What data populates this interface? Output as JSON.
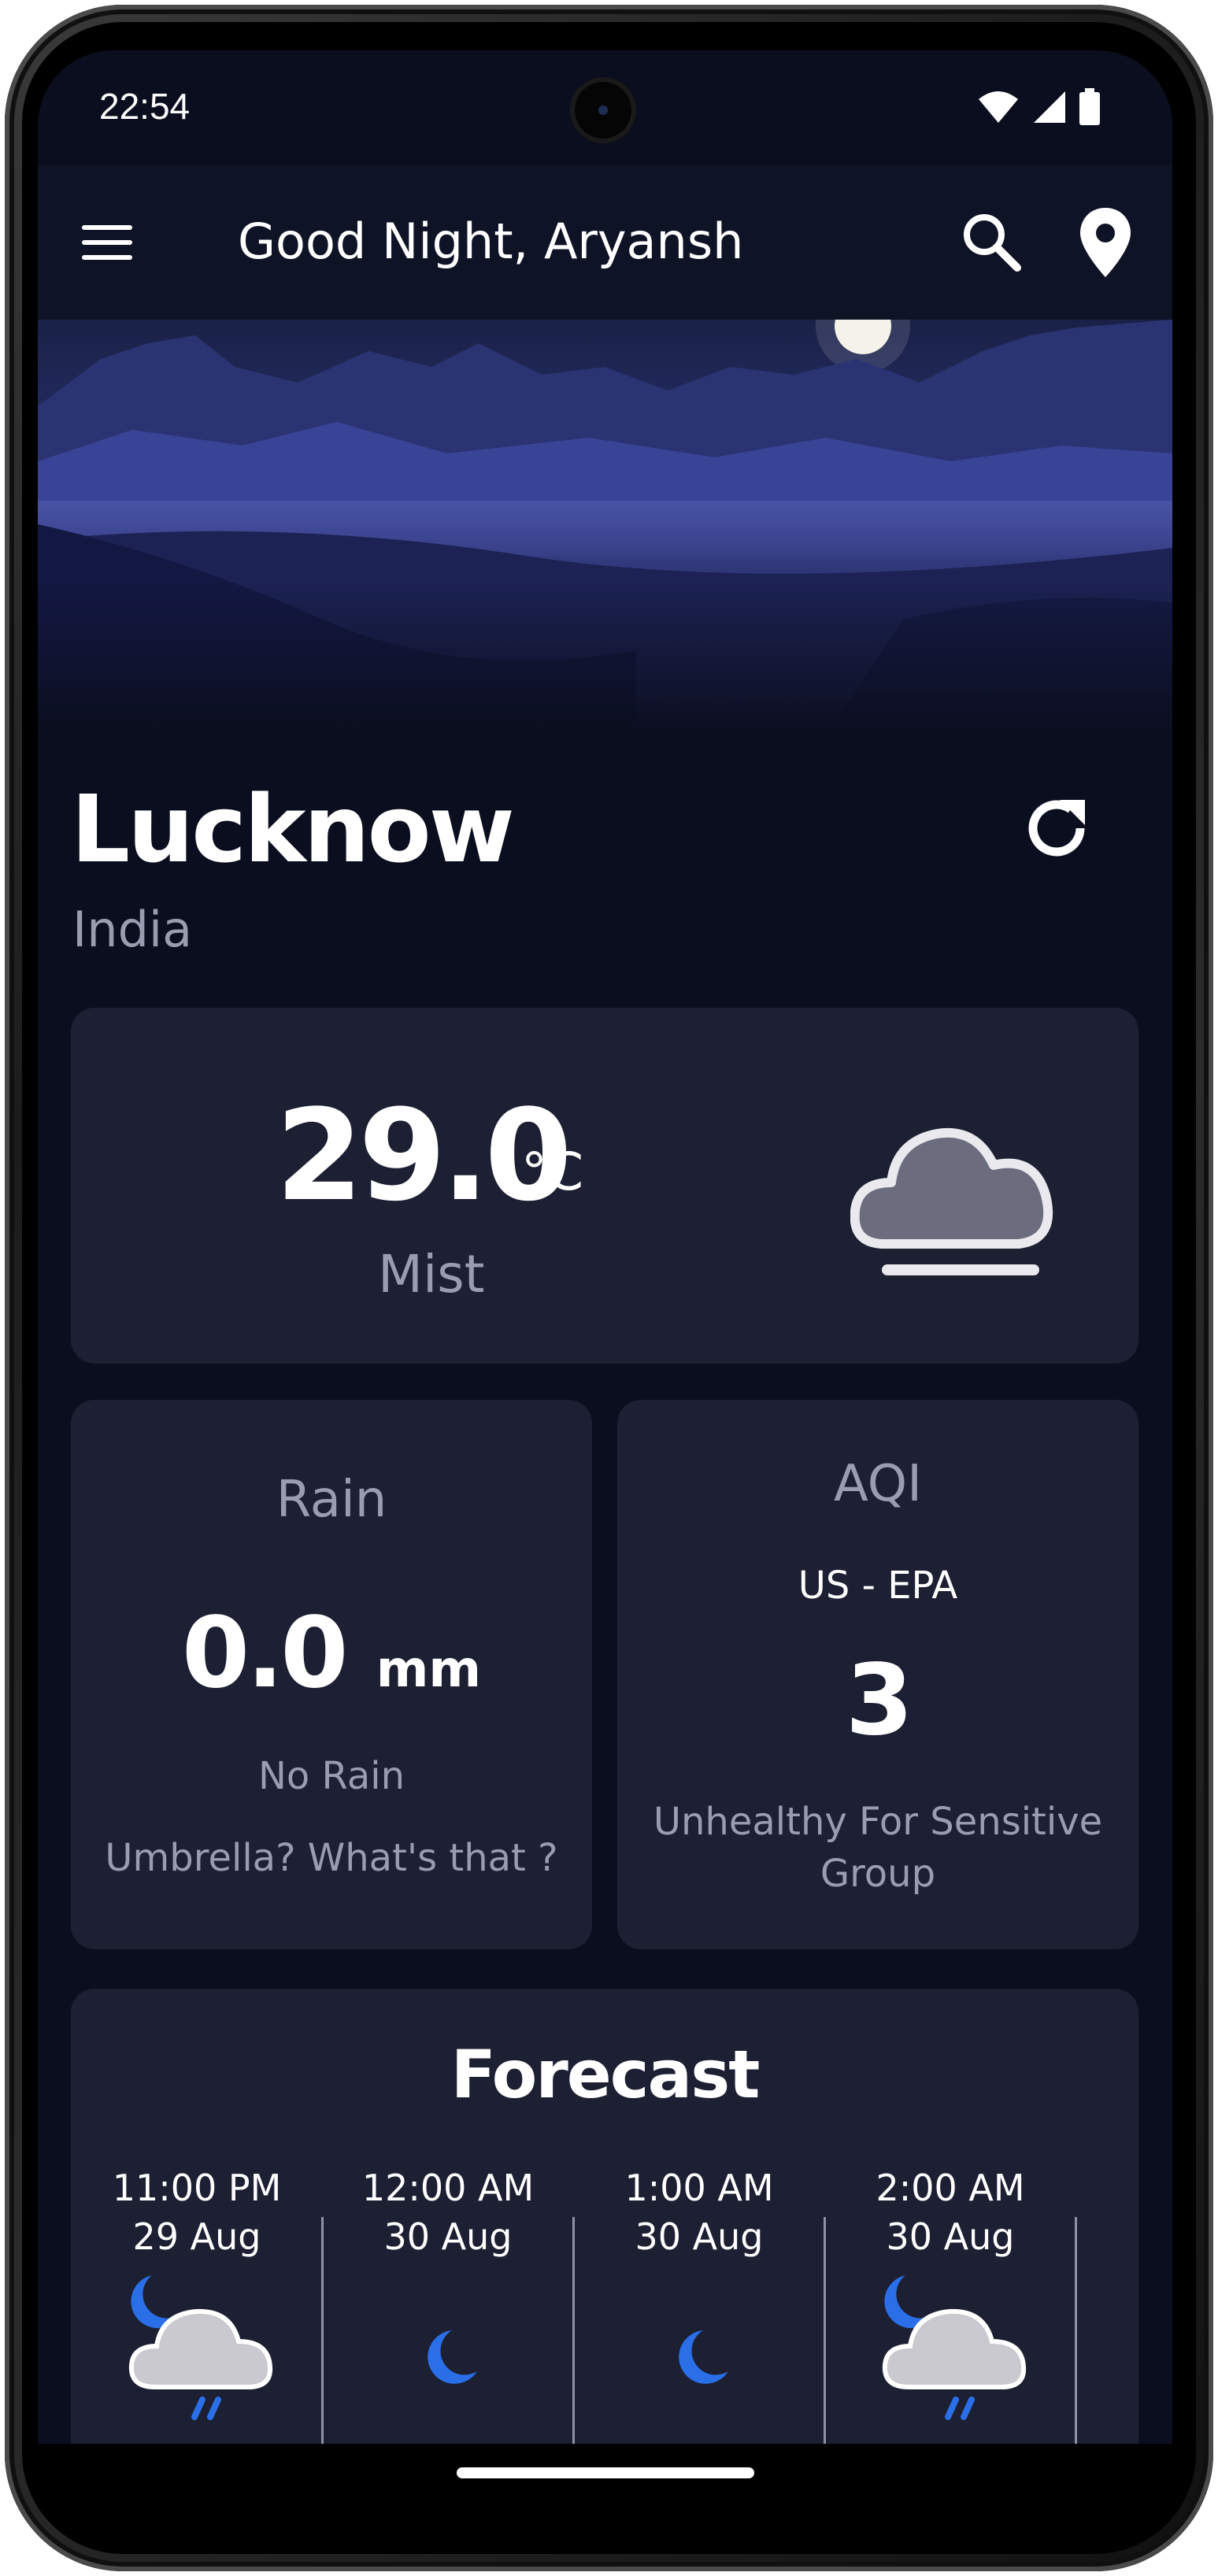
{
  "status_bar": {
    "time": "22:54"
  },
  "app_bar": {
    "greeting": "Good Night, Aryansh",
    "menu_icon": "hamburger-menu-icon",
    "search_icon": "search-icon",
    "location_icon": "location-pin-icon"
  },
  "location": {
    "city": "Lucknow",
    "country": "India",
    "refresh_icon": "refresh-icon"
  },
  "current": {
    "temperature": "29.0",
    "unit": "°C",
    "condition": "Mist",
    "icon": "mist-cloud-icon"
  },
  "rain": {
    "title": "Rain",
    "value": "0.0",
    "unit": "mm",
    "status": "No Rain",
    "note": "Umbrella? What's that ?"
  },
  "aqi": {
    "title": "AQI",
    "standard": "US - EPA",
    "value": "3",
    "category_line1": "Unhealthy For Sensitive",
    "category_line2": "Group"
  },
  "forecast": {
    "title": "Forecast",
    "items": [
      {
        "time": "11:00 PM",
        "date": "29 Aug",
        "icon": "moon-cloud-rain-icon"
      },
      {
        "time": "12:00 AM",
        "date": "30 Aug",
        "icon": "crescent-moon-icon"
      },
      {
        "time": "1:00 AM",
        "date": "30 Aug",
        "icon": "crescent-moon-icon"
      },
      {
        "time": "2:00 AM",
        "date": "30 Aug",
        "icon": "moon-cloud-rain-icon"
      }
    ]
  },
  "colors": {
    "background": "#0b0e1e",
    "card": "#1d2033",
    "text_primary": "#ffffff",
    "text_secondary": "#9a9db0",
    "accent_blue": "#2a6fe8"
  }
}
